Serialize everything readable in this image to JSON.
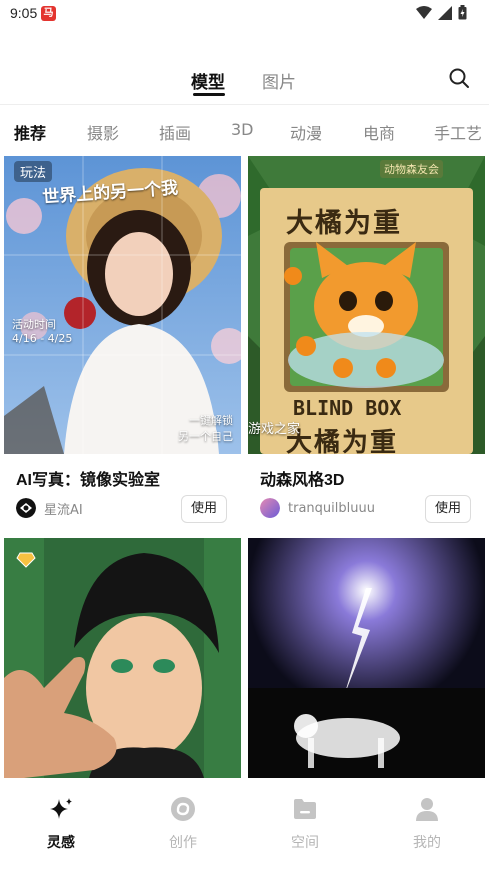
{
  "status_bar": {
    "time": "9:05",
    "app_badge": "马"
  },
  "top_tabs": [
    {
      "label": "模型",
      "active": true
    },
    {
      "label": "图片",
      "active": false
    }
  ],
  "categories": [
    "推荐",
    "摄影",
    "插画",
    "3D",
    "动漫",
    "电商",
    "手工艺"
  ],
  "cards": [
    {
      "title": "AI写真：镜像实验室",
      "author": "星流AI",
      "use_label": "使用",
      "overlay": {
        "tag": "玩法",
        "headline": "世界上的另一个我",
        "event_label": "活动时间",
        "event_dates": "4/16 - 4/25",
        "bottom_line1": "一键解锁",
        "bottom_line2": "另一个自己"
      }
    },
    {
      "title": "动森风格3D",
      "author": "tranquilbluuu",
      "use_label": "使用",
      "overlay": {
        "sign": "动物森友会",
        "box_title": "大橘为重",
        "box_text": "BLIND BOX",
        "box_bottom": "大橘为重",
        "watermark": "游戏之家"
      }
    },
    {
      "title": "",
      "author": "",
      "badge_icon": "diamond-icon"
    },
    {
      "title": "",
      "author": ""
    }
  ],
  "bottom_nav": [
    {
      "label": "灵感",
      "icon": "sparkle-icon",
      "active": true
    },
    {
      "label": "创作",
      "icon": "create-icon",
      "active": false
    },
    {
      "label": "空间",
      "icon": "folder-icon",
      "active": false
    },
    {
      "label": "我的",
      "icon": "profile-icon",
      "active": false
    }
  ],
  "colors": {
    "accent": "#111111",
    "inactive": "#b5b5b5",
    "badge": "#e3342f"
  }
}
